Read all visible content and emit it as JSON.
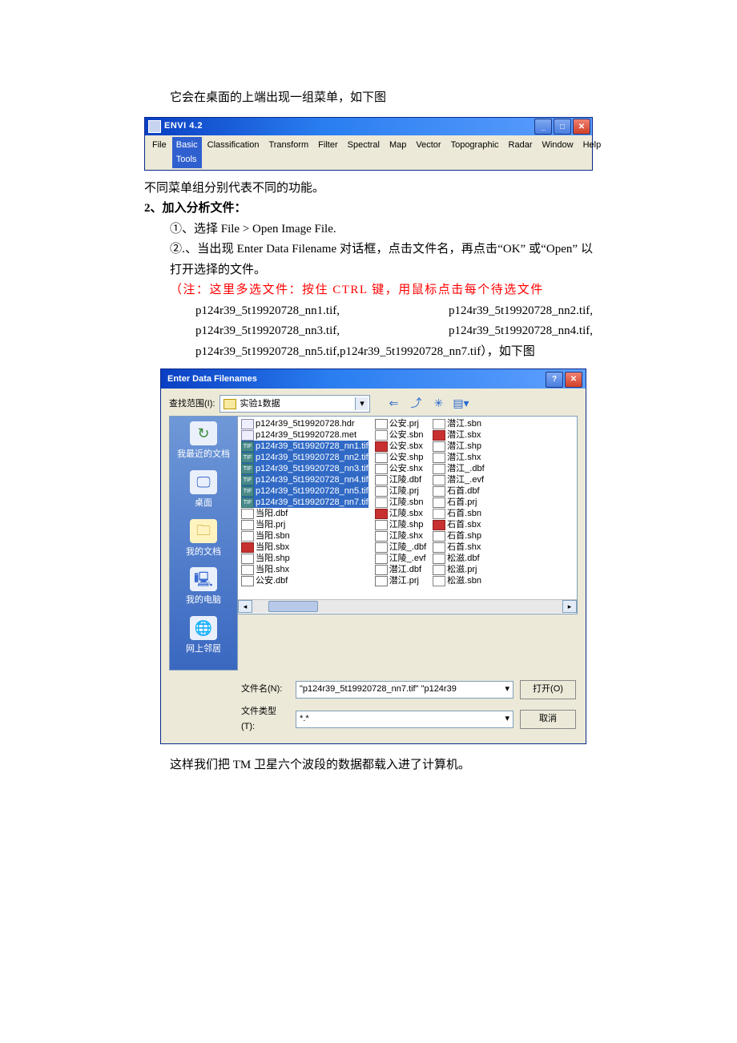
{
  "intro_text": "它会在桌面的上端出现一组菜单，如下图",
  "envi_window": {
    "title": "ENVI 4.2",
    "menu_items": [
      "File",
      "Basic Tools",
      "Classification",
      "Transform",
      "Filter",
      "Spectral",
      "Map",
      "Vector",
      "Topographic",
      "Radar",
      "Window",
      "Help"
    ]
  },
  "para_diff_menus": "不同菜单组分别代表不同的功能。",
  "section2_heading": "2、加入分析文件：",
  "step1": "①、选择  File > Open Image File.",
  "step2": "②.、当出现  Enter Data Filename  对话框，点击文件名，再点击“OK”  或“Open”  以打开选择的文件。",
  "note_line": "（注：这里多选文件：按住 CTRL 键，用鼠标点击每个待选文件",
  "note_files": [
    "p124r39_5t19920728_nn1.tif,",
    "p124r39_5t19920728_nn2.tif,",
    "p124r39_5t19920728_nn3.tif,",
    "p124r39_5t19920728_nn4.tif,",
    "p124r39_5t19920728_nn5.tif,p124r39_5t19920728_nn7.tif），如下图"
  ],
  "dialog": {
    "title": "Enter Data Filenames",
    "lookin_label": "查找范围(I):",
    "folder_name": "实验1数据",
    "places": {
      "recent": "我最近的文档",
      "desktop": "桌面",
      "documents": "我的文档",
      "computer": "我的电脑",
      "network": "网上邻居"
    },
    "columns": [
      [
        {
          "t": "p124r39_5t19920728.hdr",
          "i": "hdr"
        },
        {
          "t": "p124r39_5t19920728.met",
          "i": "hdr"
        },
        {
          "t": "p124r39_5t19920728_nn1.tif",
          "i": "tif",
          "sel": true
        },
        {
          "t": "p124r39_5t19920728_nn2.tif",
          "i": "tif",
          "sel": true
        },
        {
          "t": "p124r39_5t19920728_nn3.tif",
          "i": "tif",
          "sel": true
        },
        {
          "t": "p124r39_5t19920728_nn4.tif",
          "i": "tif",
          "sel": true
        },
        {
          "t": "p124r39_5t19920728_nn5.tif",
          "i": "tif",
          "sel": true
        },
        {
          "t": "p124r39_5t19920728_nn7.tif",
          "i": "tif",
          "sel": true
        },
        {
          "t": "当阳.dbf",
          "i": "dbf"
        },
        {
          "t": "当阳.prj",
          "i": "prj"
        },
        {
          "t": "当阳.sbn",
          "i": "sbn"
        },
        {
          "t": "当阳.sbx",
          "i": "sbx"
        },
        {
          "t": "当阳.shp",
          "i": "shp"
        },
        {
          "t": "当阳.shx",
          "i": "shx"
        },
        {
          "t": "公安.dbf",
          "i": "dbf"
        }
      ],
      [
        {
          "t": "公安.prj",
          "i": "prj"
        },
        {
          "t": "公安.sbn",
          "i": "sbn"
        },
        {
          "t": "公安.sbx",
          "i": "sbx"
        },
        {
          "t": "公安.shp",
          "i": "shp"
        },
        {
          "t": "公安.shx",
          "i": "shx"
        },
        {
          "t": "江陵.dbf",
          "i": "dbf"
        },
        {
          "t": "江陵.prj",
          "i": "prj"
        },
        {
          "t": "江陵.sbn",
          "i": "sbn"
        },
        {
          "t": "江陵.sbx",
          "i": "sbx"
        },
        {
          "t": "江陵.shp",
          "i": "shp"
        },
        {
          "t": "江陵.shx",
          "i": "shx"
        },
        {
          "t": "江陵_.dbf",
          "i": "dbf"
        },
        {
          "t": "江陵_.evf",
          "i": "evf"
        },
        {
          "t": "潜江.dbf",
          "i": "dbf"
        },
        {
          "t": "潜江.prj",
          "i": "prj"
        }
      ],
      [
        {
          "t": "潜江.sbn",
          "i": "sbn"
        },
        {
          "t": "潜江.sbx",
          "i": "sbx"
        },
        {
          "t": "潜江.shp",
          "i": "shp"
        },
        {
          "t": "潜江.shx",
          "i": "shx"
        },
        {
          "t": "潜江_.dbf",
          "i": "dbf"
        },
        {
          "t": "潜江_.evf",
          "i": "evf"
        },
        {
          "t": "石首.dbf",
          "i": "dbf"
        },
        {
          "t": "石首.prj",
          "i": "prj"
        },
        {
          "t": "石首.sbn",
          "i": "sbn"
        },
        {
          "t": "石首.sbx",
          "i": "sbx"
        },
        {
          "t": "石首.shp",
          "i": "shp"
        },
        {
          "t": "石首.shx",
          "i": "shx"
        },
        {
          "t": "松滋.dbf",
          "i": "dbf"
        },
        {
          "t": "松滋.prj",
          "i": "prj"
        },
        {
          "t": "松滋.sbn",
          "i": "sbn"
        }
      ]
    ],
    "filename_label": "文件名(N):",
    "filename_value": "\"p124r39_5t19920728_nn7.tif\" \"p124r39",
    "filetype_label": "文件类型(T):",
    "filetype_value": "*.*",
    "open_button": "打开(O)",
    "cancel_button": "取消"
  },
  "closing_text": "这样我们把 TM 卫星六个波段的数据都载入进了计算机。"
}
